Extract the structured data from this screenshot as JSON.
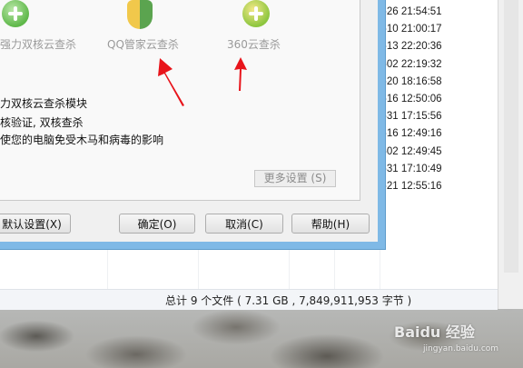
{
  "explorer": {
    "times": [
      "-26 21:54:51",
      "-10 21:00:17",
      "-13 22:20:36",
      "-02 22:19:32",
      "-20 18:16:58",
      "-16 12:50:06",
      "-31 17:15:56",
      "-16 12:49:16",
      "-02 12:49:45",
      "-31 17:10:49",
      "-21 12:55:16"
    ],
    "status": "总计 9 个文件 ( 7.31 GB , 7,849,911,953 字节 )"
  },
  "dialog": {
    "engines": [
      {
        "label": "强力双核云查杀",
        "icon": "dual-core-cloud-scan-icon"
      },
      {
        "label": "QQ管家云查杀",
        "icon": "qq-manager-shield-icon"
      },
      {
        "label": "360云查杀",
        "icon": "360-cloud-scan-icon"
      }
    ],
    "description": [
      "力双核云查杀模块",
      "核验证, 双核查杀",
      "使您的电脑免受木马和病毒的影响"
    ],
    "more_settings": "更多设置 (S)",
    "buttons": {
      "default": "默认设置(X)",
      "ok": "确定(O)",
      "cancel": "取消(C)",
      "help": "帮助(H)"
    }
  },
  "watermark": {
    "brand": "Baidu 经验",
    "url": "jingyan.baidu.com"
  },
  "colors": {
    "dialog_frame": "#7fb9e6",
    "annotation_arrow": "#e8141b",
    "disabled_text": "#9a9a9a"
  }
}
